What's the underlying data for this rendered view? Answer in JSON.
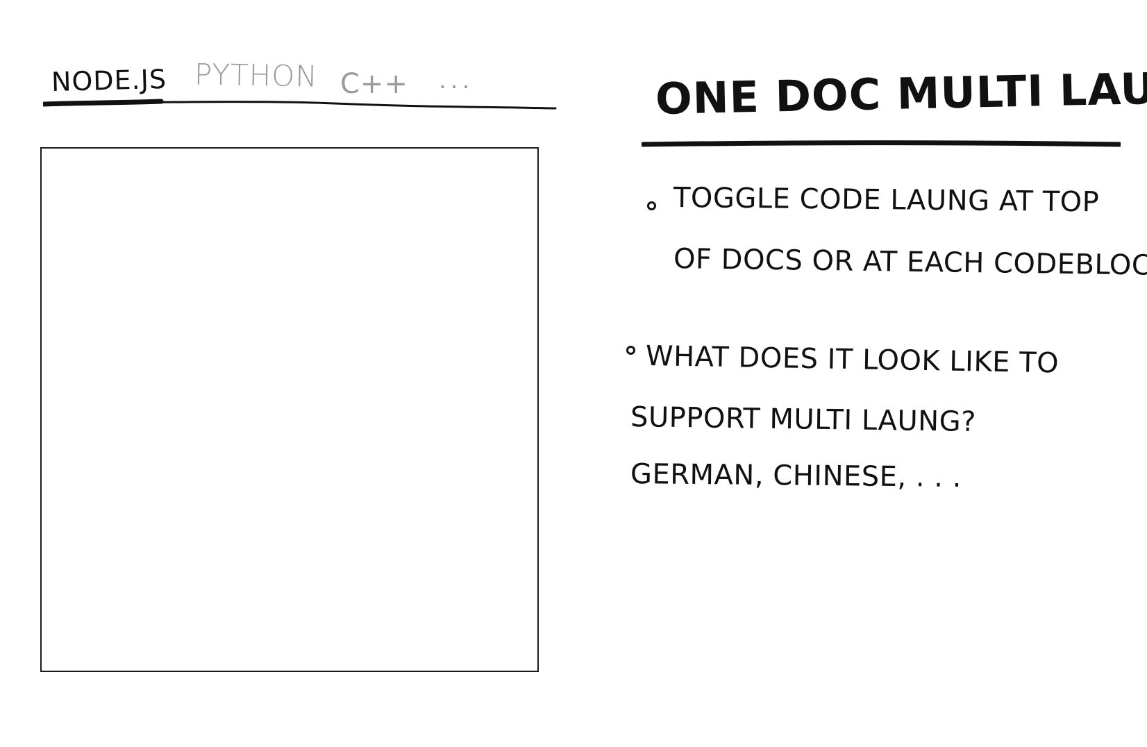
{
  "tabs": {
    "items": [
      {
        "label": "NODE.JS",
        "state": "active"
      },
      {
        "label": "PYTHON",
        "state": "inactive"
      },
      {
        "label": "C++",
        "state": "inactive"
      },
      {
        "label": "...",
        "state": "inactive"
      }
    ]
  },
  "code_panel": {
    "content": ""
  },
  "notes": {
    "title": "ONE DOC MULTI LAUNG",
    "bullet_1": {
      "line_1": "TOGGLE CODE LAUNG AT TOP",
      "line_2": "OF DOCS OR AT EACH CODEBLOCK"
    },
    "bullet_2": {
      "line_1": "WHAT DOES IT LOOK LIKE TO",
      "line_2": "SUPPORT MULTI LAUNG?",
      "line_3": "GERMAN, CHINESE, . . ."
    }
  },
  "colors": {
    "ink": "#111111",
    "inactive_tab": "#9a9a9a",
    "background": "#ffffff"
  }
}
